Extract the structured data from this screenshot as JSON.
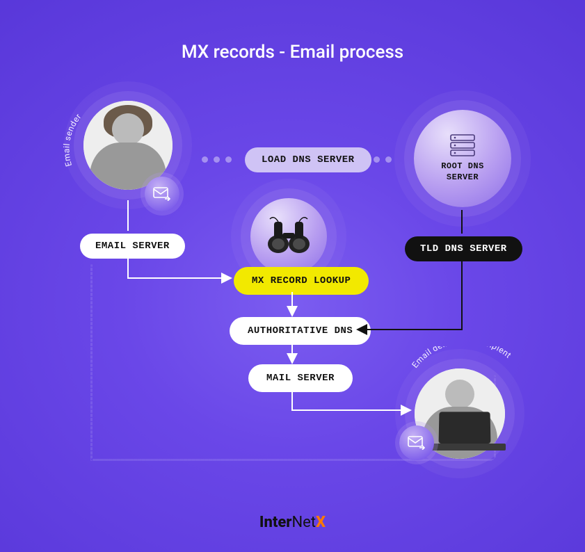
{
  "title": "MX records - Email process",
  "labels": {
    "sender_curved": "Email sender",
    "recipient_curved": "Email delivery to recipient"
  },
  "nodes": {
    "load_dns": "LOAD DNS SERVER",
    "root_dns_l1": "ROOT DNS",
    "root_dns_l2": "SERVER",
    "email_server": "EMAIL SERVER",
    "tld_dns": "TLD DNS SERVER",
    "mx_lookup": "MX RECORD LOOKUP",
    "authoritative_dns": "AUTHORITATIVE DNS",
    "mail_server": "MAIL SERVER"
  },
  "icons": {
    "root_server": "server-stack-icon",
    "binoculars": "binoculars-icon",
    "envelope": "envelope-forward-icon"
  },
  "brand": {
    "part1": "Inter",
    "part2": "Net",
    "part3": "X"
  },
  "colors": {
    "yellow": "#f2e900",
    "lavender": "#cfc3f5",
    "dark": "#111111",
    "bg_primary": "#6a47e8"
  }
}
